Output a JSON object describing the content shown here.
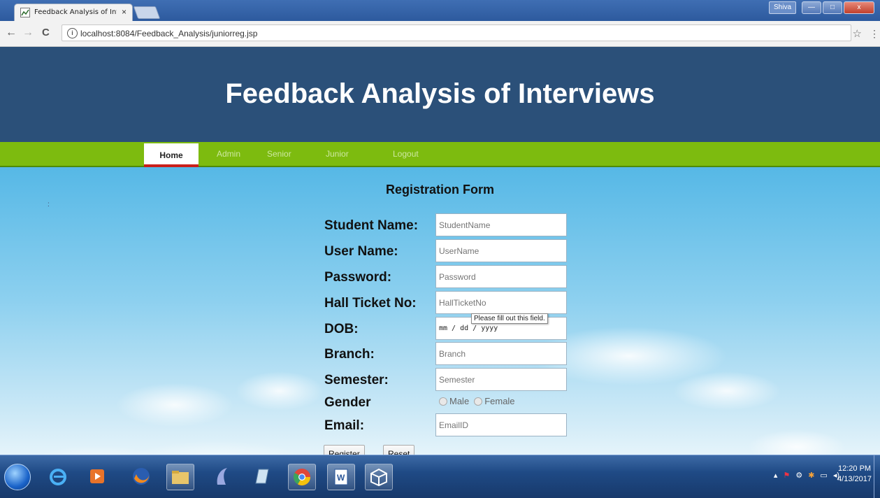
{
  "browser": {
    "tab_title": "Feedback Analysis of Inte",
    "tab_close": "×",
    "user_name": "Shiva",
    "url": "localhost:8084/Feedback_Analysis/juniorreg.jsp",
    "back": "←",
    "forward": "→",
    "reload": "C",
    "info": "i",
    "star": "☆",
    "menu": "⋮",
    "minimize": "—",
    "maximize": "□",
    "close": "x"
  },
  "header": {
    "title": "Feedback Analysis of Interviews"
  },
  "nav": {
    "items": [
      "Home",
      "Admin",
      "Senior",
      "Junior",
      "Logout"
    ],
    "active": "Home"
  },
  "form": {
    "title": "Registration Form",
    "fields": [
      {
        "label": "Student Name:",
        "placeholder": "StudentName"
      },
      {
        "label": "User Name:",
        "placeholder": "UserName"
      },
      {
        "label": "Password:",
        "placeholder": "Password"
      },
      {
        "label": "Hall Ticket No:",
        "placeholder": "HallTicketNo"
      },
      {
        "label": "DOB:",
        "placeholder": "mm / dd / yyyy"
      },
      {
        "label": "Branch:",
        "placeholder": "Branch"
      },
      {
        "label": "Semester:",
        "placeholder": "Semester"
      },
      {
        "label": "Gender",
        "options": [
          "Male",
          "Female"
        ]
      },
      {
        "label": "Email:",
        "placeholder": "EmailID"
      }
    ],
    "validation_tooltip": "Please fill out this field.",
    "register_label": "Register",
    "reset_label": "Reset"
  },
  "taskbar": {
    "time": "12:20 PM",
    "date": "4/13/2017"
  },
  "colors": {
    "header_bg": "#2b5079",
    "nav_bg": "#7dbb0f",
    "nav_active_underline": "#c9201a"
  }
}
